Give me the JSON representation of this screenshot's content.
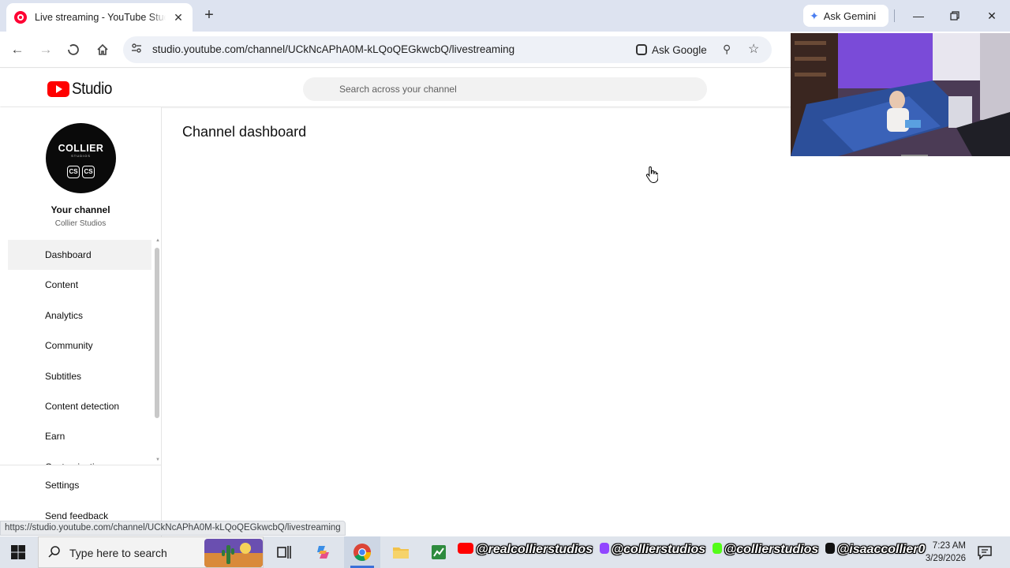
{
  "browser": {
    "tab_title": "Live streaming - YouTube Studio",
    "tab_close": "✕",
    "new_tab": "+",
    "ask_gemini": "Ask Gemini",
    "url": "studio.youtube.com/channel/UCkNcAPhA0M-kLQoQEGkwcbQ/livestreaming",
    "ask_google": "Ask Google",
    "status_url": "https://studio.youtube.com/channel/UCkNcAPhA0M-kLQoQEGkwcbQ/livestreaming"
  },
  "studio": {
    "logo_text": "Studio",
    "search_placeholder": "Search across your channel",
    "avatar_brand": "COLLIER",
    "avatar_sub": "STUDIOS",
    "avatar_mark": "CS",
    "your_channel": "Your channel",
    "channel_name": "Collier Studios",
    "nav": [
      {
        "label": "Dashboard",
        "active": true
      },
      {
        "label": "Content"
      },
      {
        "label": "Analytics"
      },
      {
        "label": "Community"
      },
      {
        "label": "Subtitles"
      },
      {
        "label": "Content detection"
      },
      {
        "label": "Earn"
      },
      {
        "label": "Customization"
      }
    ],
    "settings": "Settings",
    "send_feedback": "Send feedback",
    "page_title": "Channel dashboard"
  },
  "taskbar": {
    "search_text": "Type here to search",
    "ticker": [
      "@realcollierstudios",
      "@collierstudios",
      "@collierstudios",
      "@isaaccollier0"
    ],
    "time": "7:23 AM",
    "date": "3/29/2026"
  },
  "colors": {
    "accent_red": "#ff0000",
    "tab_strip": "#dde3f0",
    "taskbar": "#dfe4ec"
  }
}
